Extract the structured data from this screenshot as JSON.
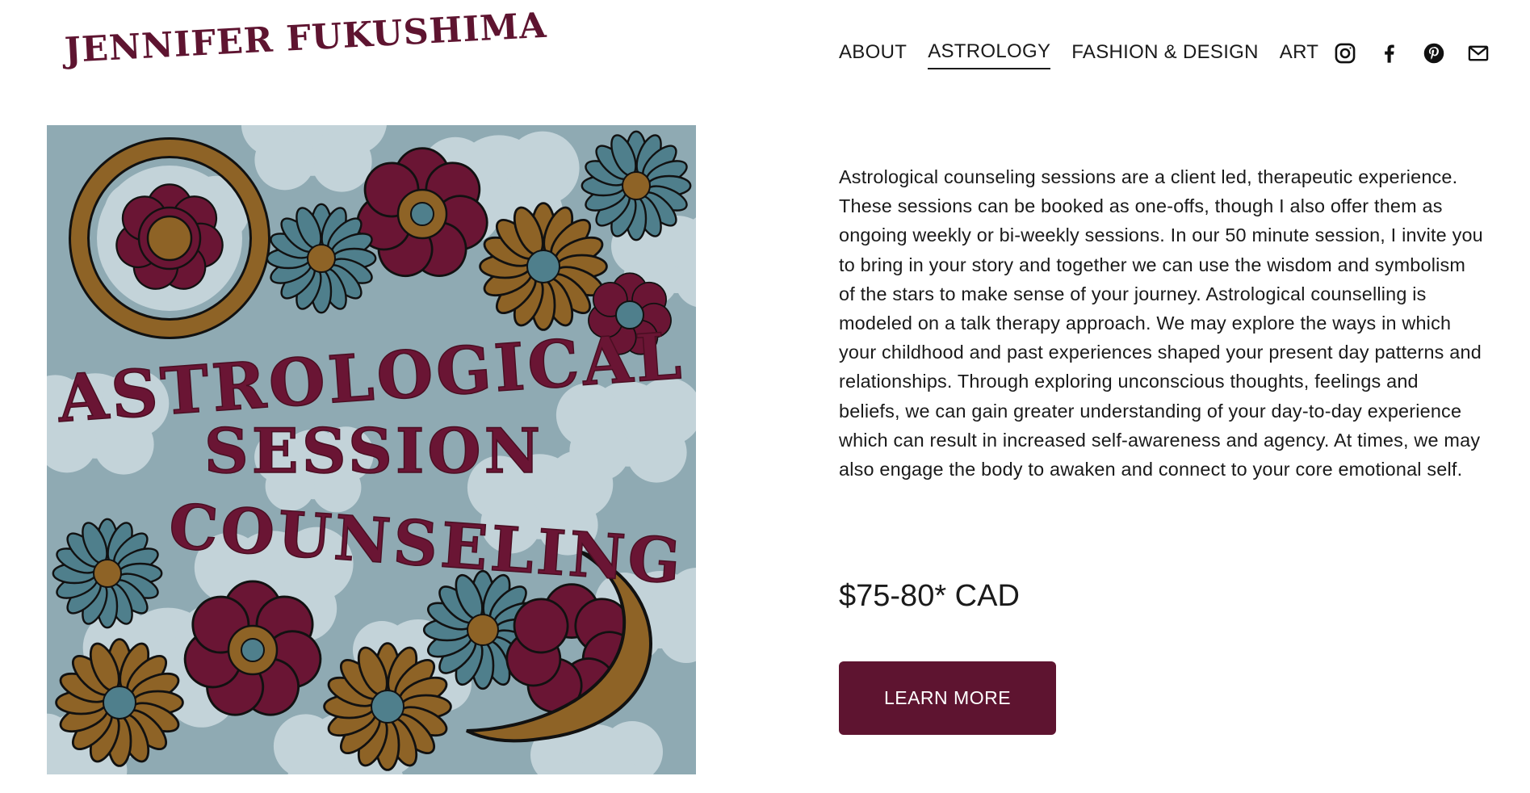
{
  "header": {
    "logo_text": "JENNIFER FUKUSHIMA",
    "nav": [
      {
        "label": "ABOUT",
        "active": false
      },
      {
        "label": "ASTROLOGY",
        "active": true
      },
      {
        "label": "FASHION & DESIGN",
        "active": false
      },
      {
        "label": "ART",
        "active": false
      }
    ],
    "social_icons": [
      "instagram-icon",
      "facebook-icon",
      "pinterest-icon",
      "email-icon"
    ]
  },
  "hero": {
    "title_lines": [
      "ASTROLOGICAL",
      "SESSION",
      "COUNSELING"
    ]
  },
  "content": {
    "description": "Astrological counseling sessions are a client led, therapeutic experience.  These sessions can be booked as one-offs, though I also offer them as ongoing weekly or bi-weekly sessions.  In our 50 minute session, I invite you to bring in your story and together we can use the wisdom and symbolism of the stars to make sense of your journey. Astrological counselling is modeled on a talk therapy approach.  We may explore the ways in which your childhood and past experiences shaped your present day patterns and relationships.  Through exploring unconscious thoughts, feelings and beliefs, we can gain greater understanding of your day-to-day experience which can result in increased self-awareness and agency.  At times, we may also engage the body to awaken and connect to your core emotional self.",
    "price": "$75-80* CAD",
    "cta_label": "LEARN MORE"
  },
  "colors": {
    "brand": "#5e1430",
    "hero_bg": "#8faab3",
    "cloud": "#c3d3d9",
    "flower_teal": "#4f7f8c",
    "flower_gold": "#8e6326",
    "flower_wine": "#6a1534"
  }
}
